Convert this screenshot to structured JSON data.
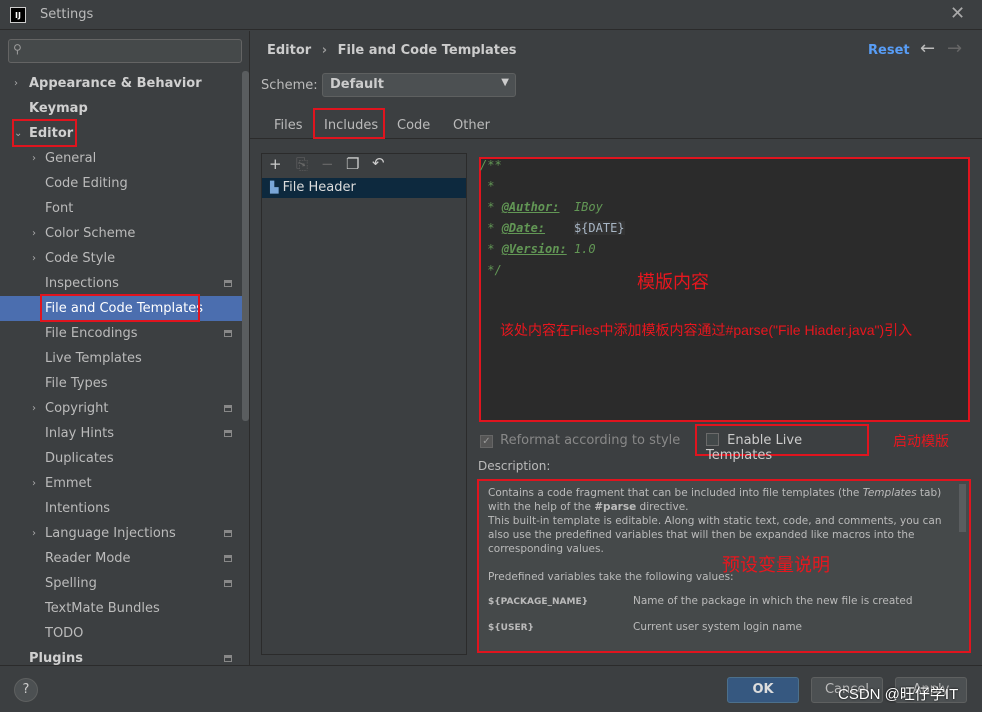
{
  "window": {
    "title": "Settings",
    "logo": "IJ",
    "close_icon": "close-icon"
  },
  "sidebar": {
    "search_placeholder": "",
    "items": [
      {
        "label": "Appearance & Behavior",
        "level": 0,
        "arrow": "›",
        "bold": true
      },
      {
        "label": "Keymap",
        "level": 0,
        "bold": true
      },
      {
        "label": "Editor",
        "level": 0,
        "arrow": "⌄",
        "bold": true
      },
      {
        "label": "General",
        "level": 1,
        "arrow": "›"
      },
      {
        "label": "Code Editing",
        "level": 1
      },
      {
        "label": "Font",
        "level": 1
      },
      {
        "label": "Color Scheme",
        "level": 1,
        "arrow": "›"
      },
      {
        "label": "Code Style",
        "level": 1,
        "arrow": "›"
      },
      {
        "label": "Inspections",
        "level": 1,
        "page": true
      },
      {
        "label": "File and Code Templates",
        "level": 1,
        "selected": true
      },
      {
        "label": "File Encodings",
        "level": 1,
        "page": true
      },
      {
        "label": "Live Templates",
        "level": 1
      },
      {
        "label": "File Types",
        "level": 1
      },
      {
        "label": "Copyright",
        "level": 1,
        "arrow": "›",
        "page": true
      },
      {
        "label": "Inlay Hints",
        "level": 1,
        "page": true
      },
      {
        "label": "Duplicates",
        "level": 1
      },
      {
        "label": "Emmet",
        "level": 1,
        "arrow": "›"
      },
      {
        "label": "Intentions",
        "level": 1
      },
      {
        "label": "Language Injections",
        "level": 1,
        "arrow": "›",
        "page": true
      },
      {
        "label": "Reader Mode",
        "level": 1,
        "page": true
      },
      {
        "label": "Spelling",
        "level": 1,
        "page": true
      },
      {
        "label": "TextMate Bundles",
        "level": 1
      },
      {
        "label": "TODO",
        "level": 1
      },
      {
        "label": "Plugins",
        "level": 0,
        "bold": true,
        "page": true
      }
    ]
  },
  "header": {
    "breadcrumb_parent": "Editor",
    "breadcrumb_sep": "›",
    "breadcrumb_current": "File and Code Templates",
    "reset": "Reset"
  },
  "scheme": {
    "label": "Scheme:",
    "value": "Default"
  },
  "tabs": [
    "Files",
    "Includes",
    "Code",
    "Other"
  ],
  "list": {
    "items": [
      "File Header"
    ]
  },
  "editor": {
    "lines": [
      "/**",
      " *"
    ],
    "author_tag": "@Author:",
    "author_value": "IBoy",
    "date_tag": "@Date:",
    "date_value": "${DATE}",
    "version_tag": "@Version:",
    "version_value": "1.0",
    "end": " */"
  },
  "annotations": {
    "template_content": "模版内容",
    "template_note": "该处内容在Files中添加模板内容通过#parse(\"File Hiader.java\")引入",
    "enable_note": "启动模版",
    "desc_note": "预设变量说明"
  },
  "options": {
    "reformat": "Reformat according to style",
    "reformat_checked": true,
    "enable_live": "Enable Live Templates",
    "enable_live_checked": false
  },
  "description": {
    "label": "Description:",
    "p1a": "Contains a code fragment that can be included into file templates (the ",
    "p1b": "Templates",
    "p1c": " tab) with the help of the ",
    "p1d": "#parse",
    "p1e": " directive.",
    "p2": "This built-in template is editable. Along with static text, code, and comments, you can also use the predefined variables that will then be expanded like macros into the corresponding values.",
    "p3": "Predefined variables take the following values:",
    "vars": [
      {
        "name": "${PACKAGE_NAME}",
        "desc": "Name of the package in which the new file is created"
      },
      {
        "name": "${USER}",
        "desc": "Current user system login name"
      }
    ]
  },
  "footer": {
    "help": "?",
    "ok": "OK",
    "cancel": "Cancel",
    "apply": "Apply",
    "watermark": "CSDN @旺仔学IT"
  },
  "colors": {
    "accent": "#4b6eaf",
    "annotation": "#e0141e",
    "comment": "#629755"
  }
}
